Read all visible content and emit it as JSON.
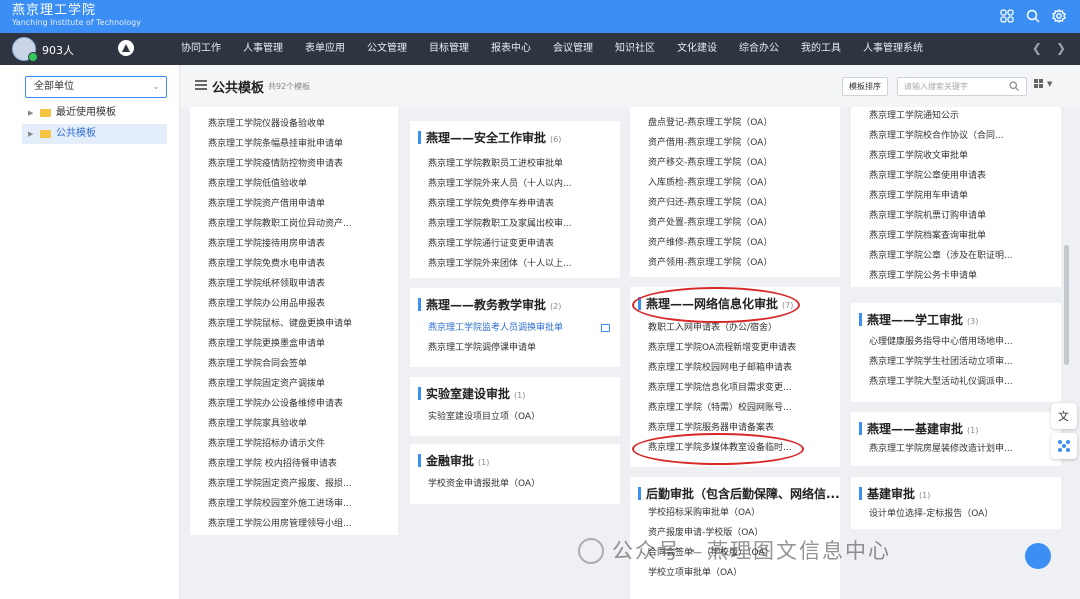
{
  "app": {
    "name_cn": "燕京理工学院",
    "name_en": "Yanching Institute of Technology"
  },
  "user": {
    "name": "903人"
  },
  "nav": {
    "items": [
      "协同工作",
      "人事管理",
      "表单应用",
      "公文管理",
      "目标管理",
      "报表中心",
      "会议管理",
      "知识社区",
      "文化建设",
      "综合办公",
      "我的工具",
      "人事管理系统"
    ]
  },
  "sidebar": {
    "unit_select": "全部单位",
    "items": [
      "最近使用模板",
      "公共模板"
    ]
  },
  "toolbar": {
    "title": "公共模板",
    "count": "共92个模板",
    "sort_label": "模板排序",
    "search_placeholder": "请输入搜索关键字"
  },
  "col1": [
    "燕京理工学院仪器设备验收单",
    "燕京理工学院条幅悬挂审批申请单",
    "燕京理工学院疫情防控物资申请表",
    "燕京理工学院低值验收单",
    "燕京理工学院资产借用申请单",
    "燕京理工学院教职工岗位异动资产...",
    "燕京理工学院接待用房申请表",
    "燕京理工学院免费水电申请表",
    "燕京理工学院纸杯领取申请表",
    "燕京理工学院办公用品申报表",
    "燕京理工学院鼠标、键盘更换申请单",
    "燕京理工学院更换墨盒申请单",
    "燕京理工学院合同会签单",
    "燕京理工学院固定资产调拨单",
    "燕京理工学院办公设备维修申请表",
    "燕京理工学院家具验收单",
    "燕京理工学院招标办请示文件",
    "燕京理工学院 校内招待餐申请表",
    "燕京理工学院固定资产报废、报损...",
    "燕京理工学院校园室外施工进场审...",
    "燕京理工学院公用房管理领导小组..."
  ],
  "col2": [
    {
      "title": "燕理——安全工作审批",
      "count": "(6)",
      "items": [
        "燕京理工学院教职员工进校审批单",
        "燕京理工学院外来人员（十人以内...",
        "燕京理工学院免费停车券申请表",
        "燕京理工学院教职工及家属出校审...",
        "燕京理工学院通行证变更申请表",
        "燕京理工学院外来团体（十人以上..."
      ]
    },
    {
      "title": "燕理——教务教学审批",
      "count": "(2)",
      "items": [
        "燕京理工学院监考人员调换审批单",
        "燕京理工学院调停课申请单"
      ]
    },
    {
      "title": "实验室建设审批",
      "count": "(1)",
      "items": [
        "实验室建设项目立项（OA）"
      ]
    },
    {
      "title": "金融审批",
      "count": "(1)",
      "items": [
        "学校资金申请报批单（OA）"
      ]
    }
  ],
  "col3_top": [
    "盘点登记-燕京理工学院（OA）",
    "资产借用-燕京理工学院（OA）",
    "资产移交-燕京理工学院（OA）",
    "入库质检-燕京理工学院（OA）",
    "资产归还-燕京理工学院（OA）",
    "资产处置-燕京理工学院（OA）",
    "资产维修-燕京理工学院（OA）",
    "资产领用-燕京理工学院（OA）"
  ],
  "col3": [
    {
      "title": "燕理——网络信息化审批",
      "count": "(7)",
      "items": [
        "教职工入网申请表（办公/宿舍）",
        "燕京理工学院OA流程新增变更申请表",
        "燕京理工学院校园网电子邮箱申请表",
        "燕京理工学院信息化项目需求变更...",
        "燕京理工学院（特需）校园网账号...",
        "燕京理工学院服务器申请备案表",
        "燕京理工学院多媒体教室设备临时..."
      ]
    },
    {
      "title": "后勤审批（包含后勤保障、网络信...",
      "count": "",
      "items": [
        "学校招标采购审批单（OA）",
        "资产报废申请-学校版（OA）",
        "合同会签单—（学校版）（OA）",
        "学校立项审批单（OA）"
      ]
    }
  ],
  "col4_top": [
    "燕京理工学院通知公示",
    "燕京理工学院校合作协议（合同...",
    "燕京理工学院收文审批单",
    "燕京理工学院公章使用申请表",
    "燕京理工学院用车申请单",
    "燕京理工学院机票订购申请单",
    "燕京理工学院档案查询审批单",
    "燕京理工学院公章（涉及在职证明...",
    "燕京理工学院公务卡申请单"
  ],
  "col4": [
    {
      "title": "燕理——学工审批",
      "count": "(3)",
      "items": [
        "心理健康服务指导中心借用场地申...",
        "燕京理工学院学生社团活动立项审...",
        "燕京理工学院大型活动礼仪调派申..."
      ]
    },
    {
      "title": "燕理——基建审批",
      "count": "(1)",
      "items": [
        "燕京理工学院房屋装修改造计划申..."
      ]
    },
    {
      "title": "基建审批",
      "count": "(1)",
      "items": [
        "设计单位选择-定标报告（OA）"
      ]
    }
  ],
  "watermark": {
    "text": "公众号 · 燕理图文信息中心"
  },
  "colors": {
    "topbar": "#3b8ef3",
    "navbar": "#2f3540",
    "accent": "#3b8ef3",
    "highlight_ring": "#d82727"
  }
}
